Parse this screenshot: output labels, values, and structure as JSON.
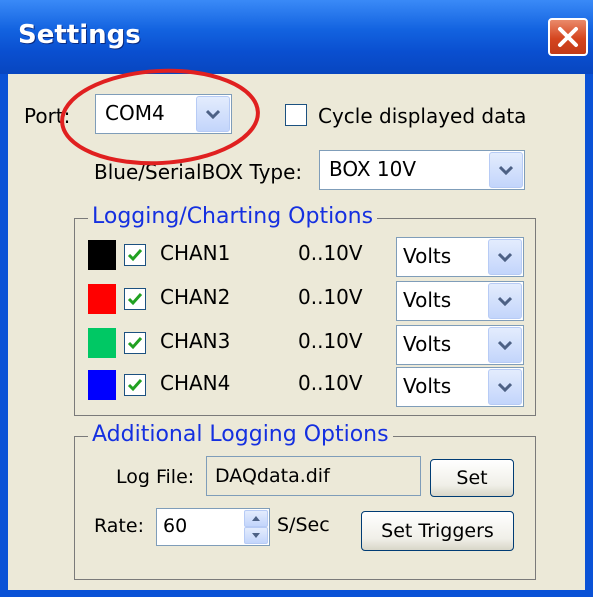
{
  "window": {
    "title": "Settings"
  },
  "port": {
    "label": "Port:",
    "value": "COM4"
  },
  "cycle": {
    "label": "Cycle displayed data",
    "checked": false
  },
  "box_type": {
    "label": "Blue/SerialBOX Type:",
    "value": "BOX 10V"
  },
  "logging": {
    "title": "Logging/Charting Options",
    "channels": [
      {
        "color": "#000000",
        "name": "CHAN1",
        "range": "0..10V",
        "unit": "Volts",
        "checked": true
      },
      {
        "color": "#ff0000",
        "name": "CHAN2",
        "range": "0..10V",
        "unit": "Volts",
        "checked": true
      },
      {
        "color": "#00c864",
        "name": "CHAN3",
        "range": "0..10V",
        "unit": "Volts",
        "checked": true
      },
      {
        "color": "#0000ff",
        "name": "CHAN4",
        "range": "0..10V",
        "unit": "Volts",
        "checked": true
      }
    ]
  },
  "additional": {
    "title": "Additional Logging Options",
    "log_file_label": "Log File:",
    "log_file_value": "DAQdata.dif",
    "set_label": "Set",
    "rate_label": "Rate:",
    "rate_value": "60",
    "rate_unit": "S/Sec",
    "set_triggers_label": "Set Triggers"
  },
  "colors": {
    "accent": "#0a52d6",
    "legend_text": "#1530e0",
    "annotation_circle": "#e02020"
  }
}
